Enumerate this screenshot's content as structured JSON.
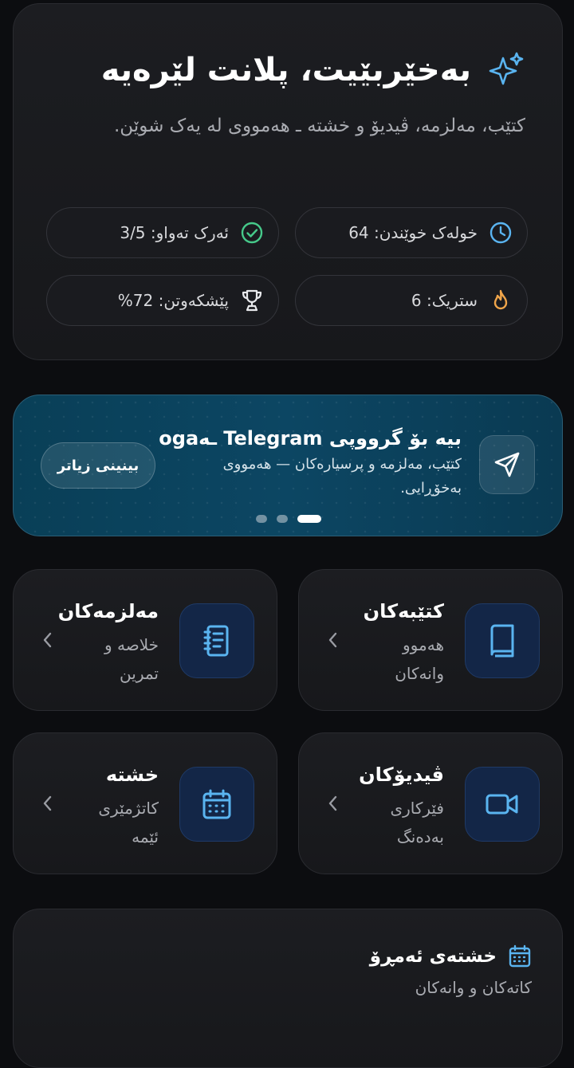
{
  "hero": {
    "title": "بەخێربێیت، پلانت لێرەیە",
    "subtitle": "کتێب، مەلزمە، ڤیدیۆ و خشتە ـ هەمووی لە یەک شوێن.",
    "stats": [
      {
        "label": "خولەک خوێندن: 64",
        "icon": "clock-icon"
      },
      {
        "label": "ئەرک تەواو: 3/5",
        "icon": "check-circle-icon"
      },
      {
        "label": "ستریک: 6",
        "icon": "flame-icon"
      },
      {
        "label": "پێشکەوتن: 72%",
        "icon": "trophy-icon"
      }
    ]
  },
  "promo": {
    "title": "بیە بۆ گرووپی Telegram ـەoga",
    "description": "کتێب، مەلزمە و پرسیارەکان — هەمووی بەخۆڕایی.",
    "cta": "بینینی زیاتر",
    "icon": "send-icon",
    "slides": 3,
    "active_slide": 3
  },
  "tiles": [
    {
      "title": "کتێبەکان",
      "subtitle": "هەموو وانەکان",
      "icon": "book-icon"
    },
    {
      "title": "مەلزمەکان",
      "subtitle": "خلاصە و تمرین",
      "icon": "notebook-icon"
    },
    {
      "title": "ڤیدیۆکان",
      "subtitle": "فێرکاری بەدەنگ",
      "icon": "video-icon"
    },
    {
      "title": "خشتە",
      "subtitle": "کاتژمێری ئێمە",
      "icon": "calendar-icon"
    }
  ],
  "today": {
    "title": "خشتەی ئەمڕۆ",
    "subtitle": "کاتەکان و وانەکان",
    "icon": "calendar-icon"
  },
  "colors": {
    "background": "#0c0d10",
    "card": "#1c1d21",
    "accent_blue": "#5ab4f0",
    "promo": "#0b4360",
    "success": "#46c98a",
    "warning": "#f0a54a"
  }
}
